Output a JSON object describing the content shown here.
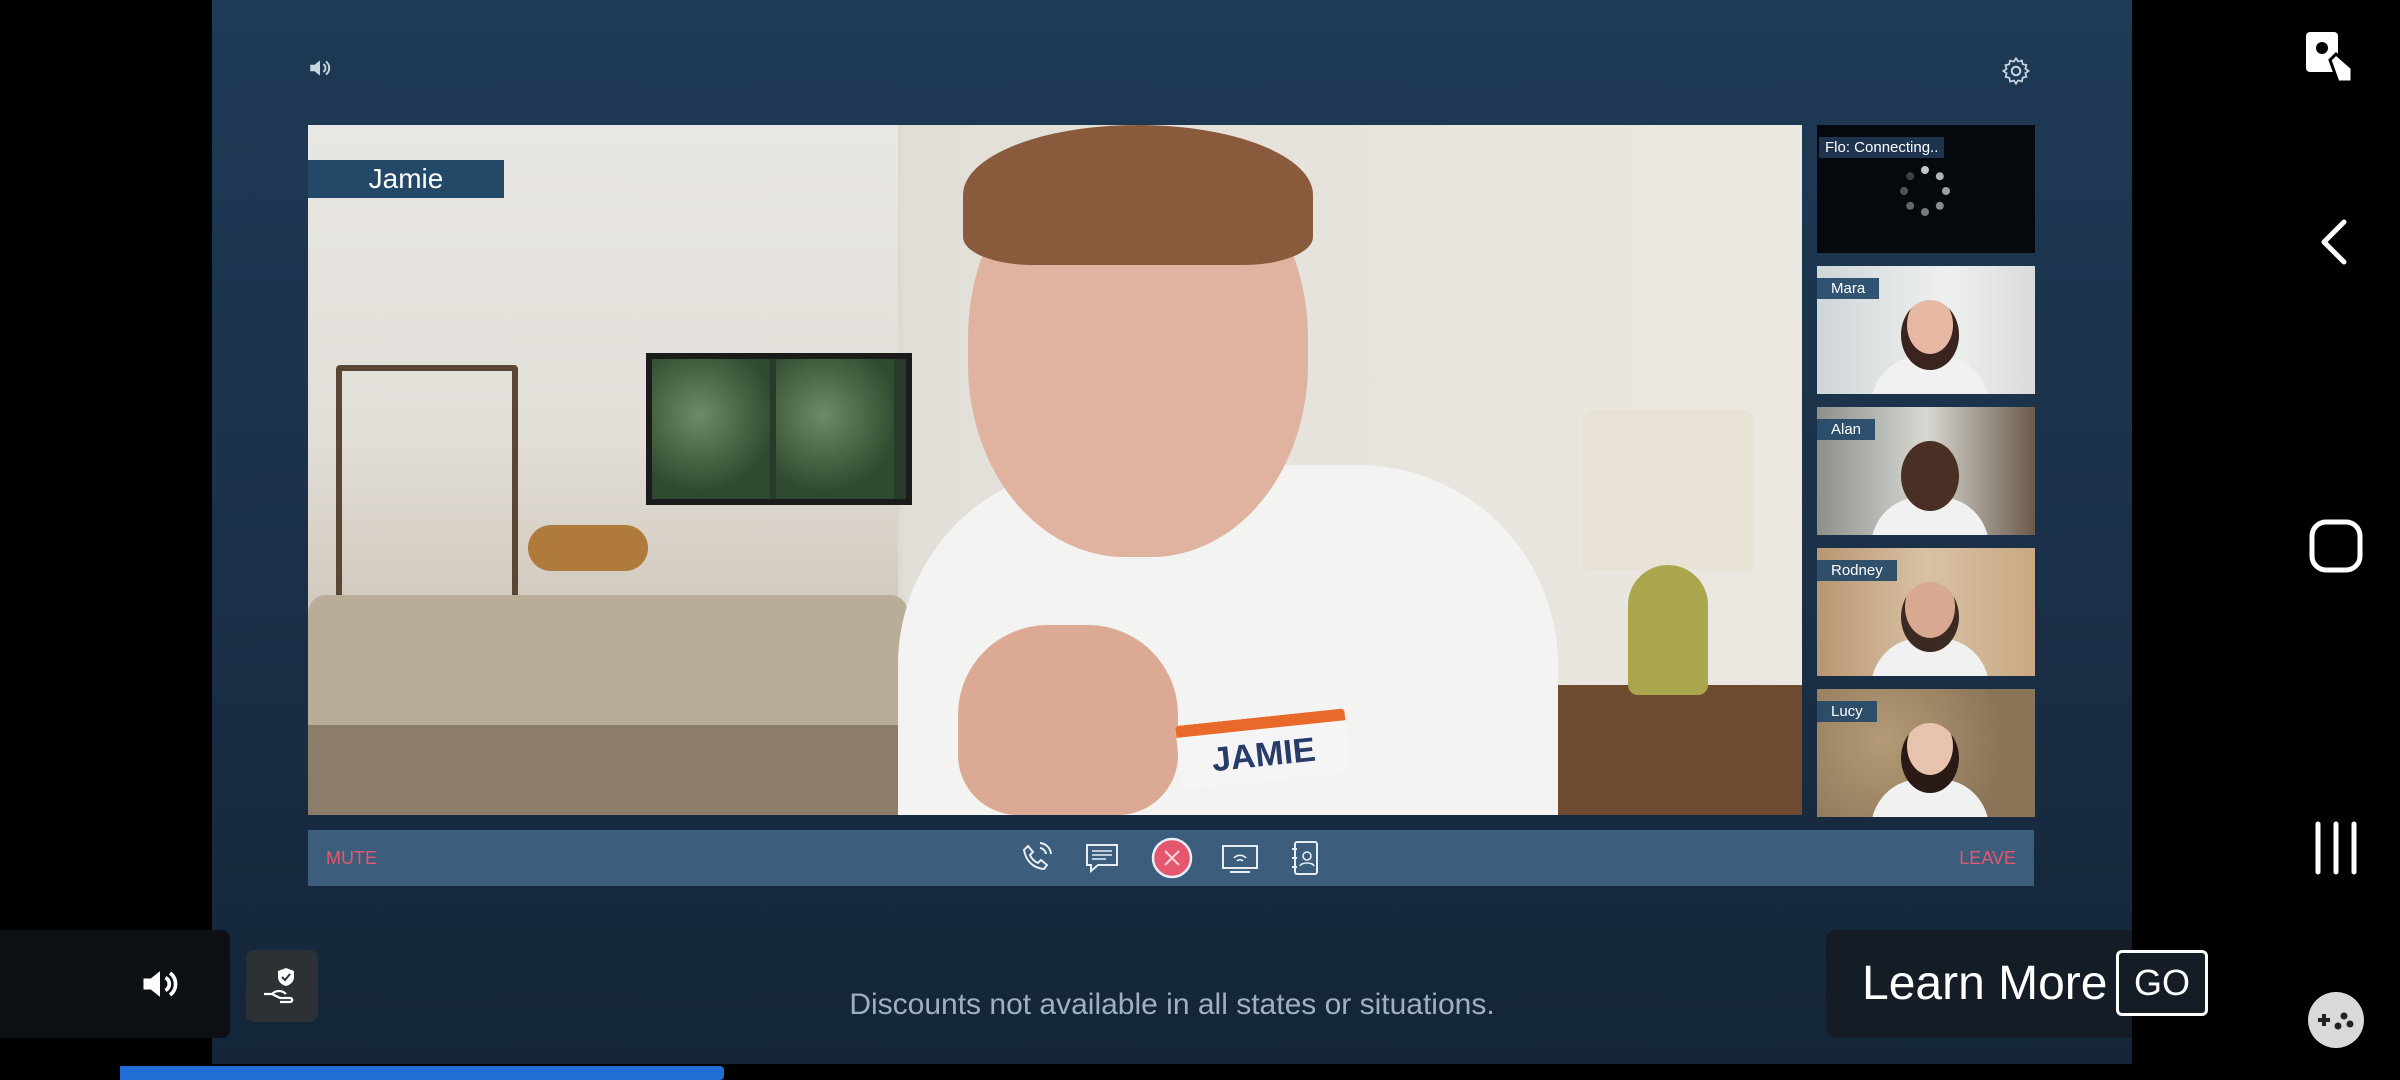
{
  "main": {
    "speaker_name": "Jamie",
    "name_tag": "JAMIE"
  },
  "participants": [
    {
      "name": "Flo: Connecting..",
      "status": "connecting"
    },
    {
      "name": "Mara"
    },
    {
      "name": "Alan"
    },
    {
      "name": "Rodney"
    },
    {
      "name": "Lucy"
    }
  ],
  "controls": {
    "mute_label": "MUTE",
    "leave_label": "LEAVE",
    "icons": [
      "phone-icon",
      "chat-icon",
      "close-circle-icon",
      "screen-share-icon",
      "contacts-icon"
    ]
  },
  "ad": {
    "disclaimer": "Discounts not available in all states or situations.",
    "learn_more": "Learn More",
    "go": "GO",
    "progress": 0.3
  },
  "colors": {
    "accent_red": "#e4576f",
    "bar_bg": "#3c5d7c",
    "progress_blue": "#1f6fd6"
  },
  "system_nav": [
    "screenshot-icon",
    "back-icon",
    "home-icon",
    "recents-icon",
    "game-tools-icon"
  ]
}
